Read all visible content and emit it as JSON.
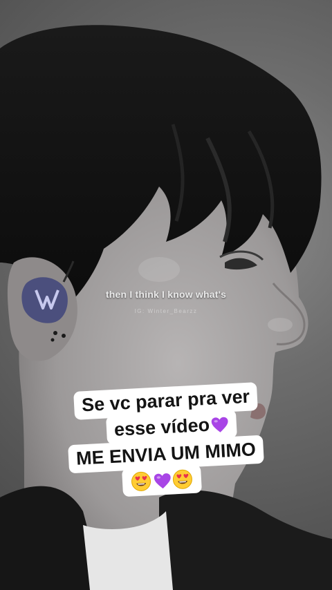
{
  "video": {
    "subtitle": "then I think I know what's",
    "watermark": "IG: Winter_Bearzz"
  },
  "caption": {
    "line1": "Se vc parar pra ver",
    "line2": "esse vídeo",
    "line3": "ME ENVIA UM MIMO",
    "emoji_line2": "purple-heart-icon",
    "emoji_line4": [
      "smiling-face-heart-eyes-icon",
      "purple-heart-icon",
      "smiling-face-heart-eyes-icon"
    ]
  },
  "colors": {
    "background": "#6f6f6f",
    "caption_bg": "#ffffff",
    "caption_text": "#141414",
    "heart": "#a845e6",
    "earpiece": "#4b4f7d"
  }
}
